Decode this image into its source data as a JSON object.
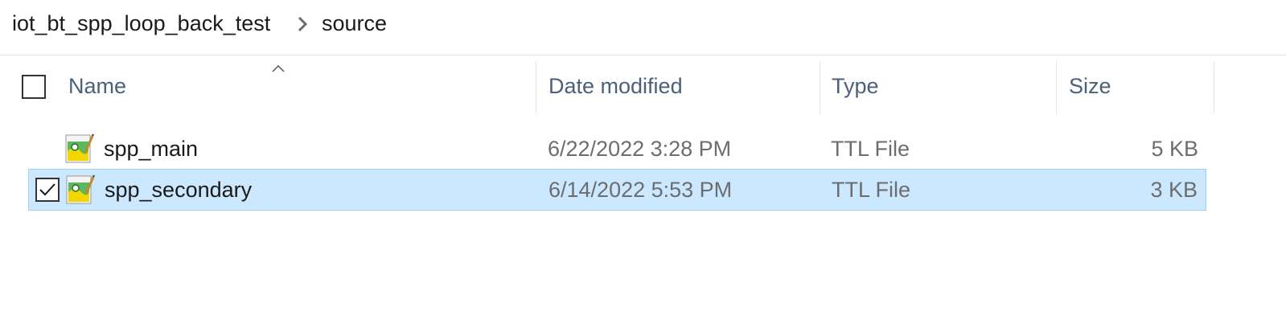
{
  "breadcrumb": {
    "parent": "iot_bt_spp_loop_back_test",
    "current": "source",
    "separator_icon": "chevron-right-icon"
  },
  "columns": {
    "name": "Name",
    "date_modified": "Date modified",
    "type": "Type",
    "size": "Size",
    "sort_indicator_icon": "sort-up-caret-icon"
  },
  "files": [
    {
      "name": "spp_main",
      "date_modified": "6/22/2022 3:28 PM",
      "type": "TTL File",
      "size": "5 KB",
      "selected": false,
      "icon": "ttl-file-icon"
    },
    {
      "name": "spp_secondary",
      "date_modified": "6/14/2022 5:53 PM",
      "type": "TTL File",
      "size": "3 KB",
      "selected": true,
      "icon": "ttl-file-icon"
    }
  ],
  "colors": {
    "selection_bg": "#cce8ff",
    "selection_border": "#99d1ff",
    "header_text": "#4c607a",
    "secondary_text": "#6d6d6d"
  }
}
